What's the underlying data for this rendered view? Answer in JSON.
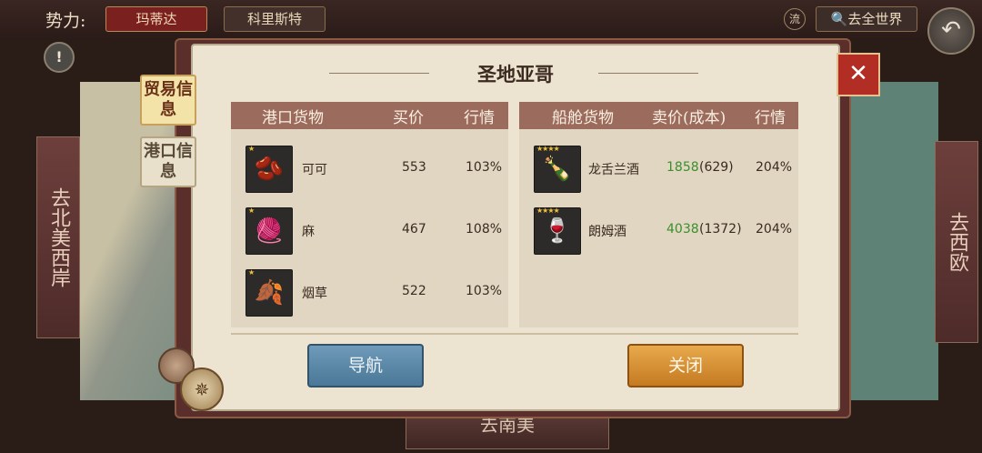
{
  "top": {
    "faction_label": "势力:",
    "faction_1": "玛蒂达",
    "faction_2": "科里斯特",
    "flow_icon": "流",
    "world_button": "🔍去全世界",
    "back_icon": "back-arrow-icon",
    "alert_icon": "!"
  },
  "side": {
    "left_tab": "去北美西岸",
    "right_tab": "去西欧",
    "bottom_tab": "去南美"
  },
  "panel": {
    "title": "圣地亚哥",
    "tab_trade": "贸易信息",
    "tab_port": "港口信息",
    "close_icon": "✕"
  },
  "port_table": {
    "headers": {
      "name": "港口货物",
      "price": "买价",
      "market": "行情"
    },
    "rows": [
      {
        "name": "可可",
        "price": "553",
        "market": "103%",
        "stars": "★",
        "icon": "cocoa-icon"
      },
      {
        "name": "麻",
        "price": "467",
        "market": "108%",
        "stars": "★",
        "icon": "hemp-icon"
      },
      {
        "name": "烟草",
        "price": "522",
        "market": "103%",
        "stars": "★",
        "icon": "tobacco-icon"
      }
    ]
  },
  "ship_table": {
    "headers": {
      "name": "船舱货物",
      "price": "卖价(成本)",
      "market": "行情"
    },
    "rows": [
      {
        "name": "龙舌兰酒",
        "sell": "1858",
        "cost": "(629)",
        "market": "204%",
        "stars": "★★★★",
        "icon": "tequila-bottle-icon"
      },
      {
        "name": "朗姆酒",
        "sell": "4038",
        "cost": "(1372)",
        "market": "204%",
        "stars": "★★★★",
        "icon": "rum-bottle-icon"
      }
    ]
  },
  "buttons": {
    "navigate": "导航",
    "close": "关闭"
  },
  "colors": {
    "profit_green": "#3b8f2c",
    "header_bg": "#9b6c5e",
    "nav_button": "#5a87a7",
    "close_button": "#d89036"
  }
}
